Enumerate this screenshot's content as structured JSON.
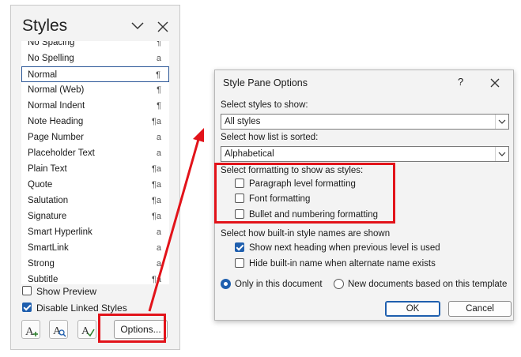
{
  "styles_pane": {
    "title": "Styles",
    "items": [
      {
        "name": "No Spacing",
        "glyph": "¶"
      },
      {
        "name": "No Spelling",
        "glyph": "a"
      },
      {
        "name": "Normal",
        "glyph": "¶"
      },
      {
        "name": "Normal (Web)",
        "glyph": "¶"
      },
      {
        "name": "Normal Indent",
        "glyph": "¶"
      },
      {
        "name": "Note Heading",
        "glyph": "¶a"
      },
      {
        "name": "Page Number",
        "glyph": "a"
      },
      {
        "name": "Placeholder Text",
        "glyph": "a"
      },
      {
        "name": "Plain Text",
        "glyph": "¶a"
      },
      {
        "name": "Quote",
        "glyph": "¶a"
      },
      {
        "name": "Salutation",
        "glyph": "¶a"
      },
      {
        "name": "Signature",
        "glyph": "¶a"
      },
      {
        "name": "Smart Hyperlink",
        "glyph": "a"
      },
      {
        "name": "SmartLink",
        "glyph": "a"
      },
      {
        "name": "Strong",
        "glyph": "a"
      },
      {
        "name": "Subtitle",
        "glyph": "¶a"
      }
    ],
    "selected_item": "Normal",
    "show_preview_label": "Show Preview",
    "show_preview_checked": false,
    "disable_linked_label": "Disable Linked Styles",
    "disable_linked_checked": true,
    "options_button": "Options...",
    "icons": [
      "new-style-icon",
      "style-inspector-icon",
      "manage-styles-icon"
    ]
  },
  "dialog": {
    "title": "Style Pane Options",
    "help": "?",
    "styles_to_show_label": "Select styles to show:",
    "styles_to_show_value": "All styles",
    "sort_label": "Select how list is sorted:",
    "sort_value": "Alphabetical",
    "formatting_label": "Select formatting to show as styles:",
    "formatting_options": [
      {
        "label": "Paragraph level formatting",
        "checked": false
      },
      {
        "label": "Font formatting",
        "checked": false
      },
      {
        "label": "Bullet and numbering formatting",
        "checked": false
      }
    ],
    "builtin_label": "Select how built-in style names are shown",
    "builtin_options": [
      {
        "label": "Show next heading when previous level is used",
        "checked": true
      },
      {
        "label": "Hide built-in name when alternate name exists",
        "checked": false
      }
    ],
    "scope_options": [
      {
        "label": "Only in this document",
        "selected": true
      },
      {
        "label": "New documents based on this template",
        "selected": false
      }
    ],
    "ok_label": "OK",
    "cancel_label": "Cancel"
  },
  "colors": {
    "highlight": "#e2131a",
    "accent": "#1f5fae"
  }
}
